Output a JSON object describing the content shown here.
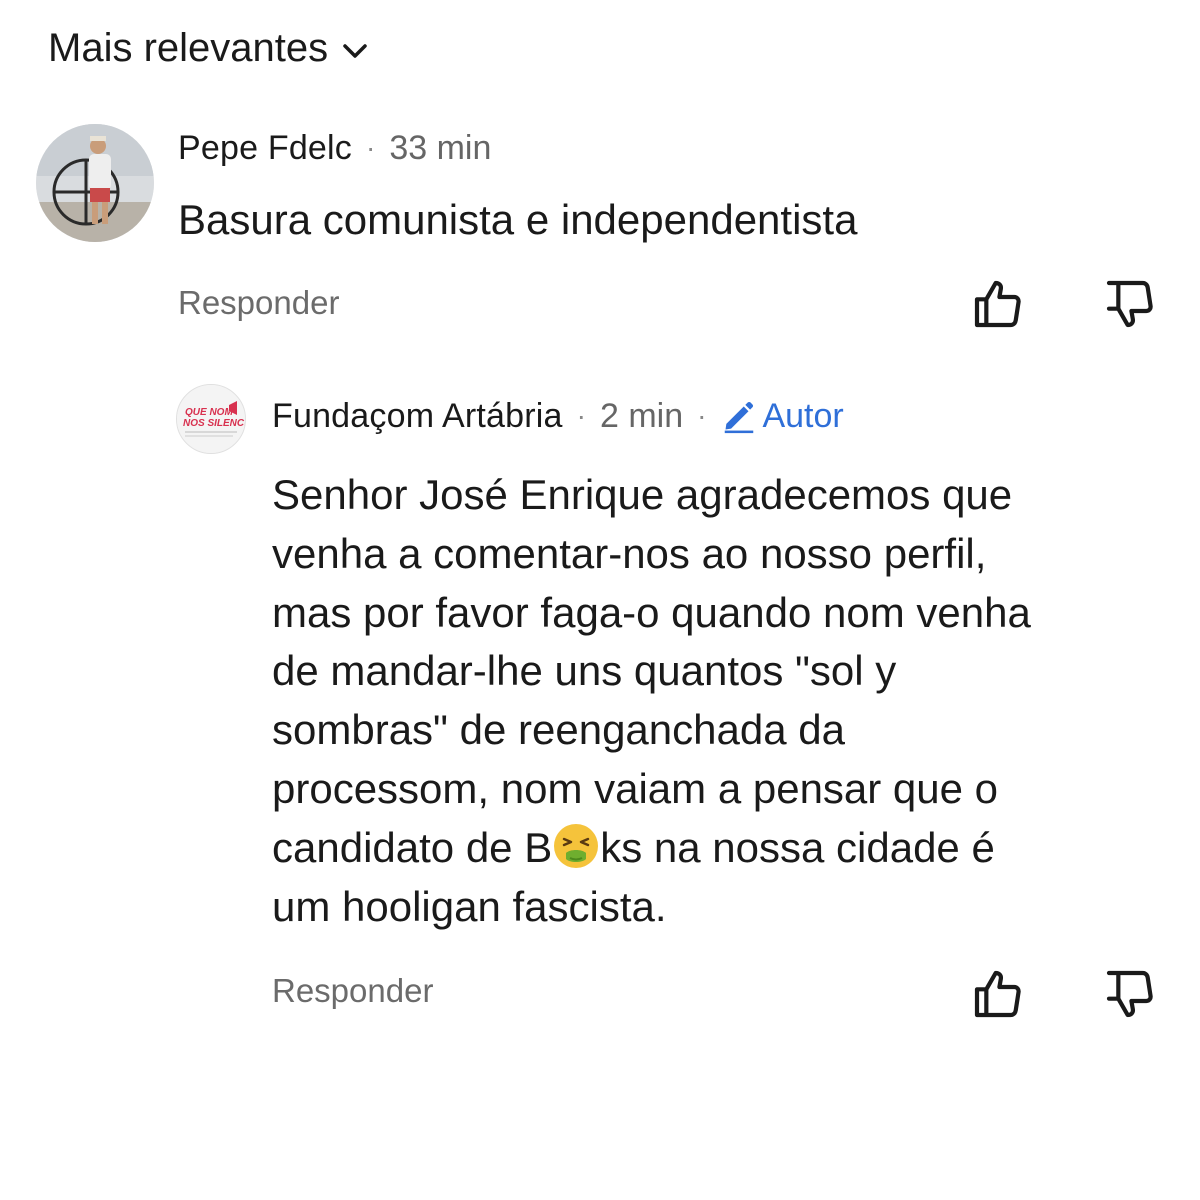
{
  "sort": {
    "label": "Mais relevantes",
    "chevron_icon": "chevron-down-icon"
  },
  "comments": [
    {
      "author": "Pepe Fdelc",
      "separator": "·",
      "time": "33 min",
      "text": "Basura comunista e independentista",
      "reply_label": "Responder",
      "avatar_icon": "user-photo-avatar",
      "like_icon": "thumbs-up-icon",
      "dislike_icon": "thumbs-down-icon"
    },
    {
      "author": "Fundaçom Artábria",
      "separator": "·",
      "time": "2 min",
      "badge_separator": "·",
      "badge_label": "Autor",
      "badge_icon": "pencil-icon",
      "text_before_emoji": "Senhor José Enrique agradecemos que\nvenha a comentar-nos ao nosso perfil,\nmas por favor faga-o quando nom venha\nde mandar-lhe uns quantos \"sol y\nsombras\" de reenganchada da\nprocessom, nom vaiam a pensar que o\ncandidato de B",
      "emoji": "nauseated-face-emoji",
      "text_after_emoji": "ks na nossa cidade é\num hooligan fascista.",
      "reply_label": "Responder",
      "avatar_logo_text": "QUE NOM NOS SILENCIEM",
      "like_icon": "thumbs-up-icon",
      "dislike_icon": "thumbs-down-icon"
    }
  ],
  "colors": {
    "text": "#1a1a1a",
    "muted": "#6b6b6b",
    "author_badge": "#2f6fd8",
    "logo_red": "#d8314f"
  }
}
